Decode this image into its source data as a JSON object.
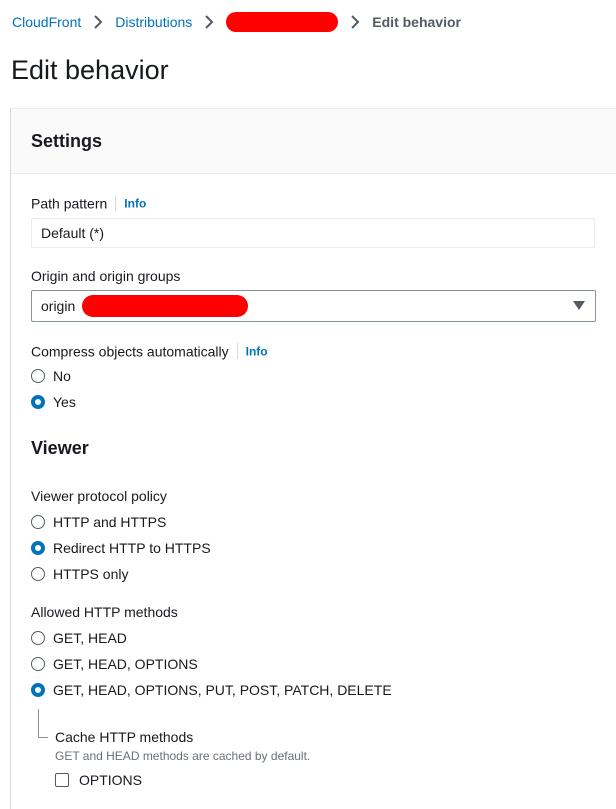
{
  "breadcrumb": {
    "items": [
      {
        "label": "CloudFront"
      },
      {
        "label": "Distributions"
      }
    ],
    "current": "Edit behavior"
  },
  "page_title": "Edit behavior",
  "settings": {
    "title": "Settings",
    "path_pattern": {
      "label": "Path pattern",
      "info": "Info",
      "value": "Default (*)"
    },
    "origin": {
      "label": "Origin and origin groups",
      "value_prefix": "origin"
    },
    "compress": {
      "label": "Compress objects automatically",
      "info": "Info",
      "options": [
        "No",
        "Yes"
      ],
      "selected": "Yes"
    }
  },
  "viewer": {
    "title": "Viewer",
    "protocol_policy": {
      "label": "Viewer protocol policy",
      "options": [
        "HTTP and HTTPS",
        "Redirect HTTP to HTTPS",
        "HTTPS only"
      ],
      "selected": "Redirect HTTP to HTTPS"
    },
    "allowed_methods": {
      "label": "Allowed HTTP methods",
      "options": [
        "GET, HEAD",
        "GET, HEAD, OPTIONS",
        "GET, HEAD, OPTIONS, PUT, POST, PATCH, DELETE"
      ],
      "selected": "GET, HEAD, OPTIONS, PUT, POST, PATCH, DELETE"
    },
    "cache_methods": {
      "label": "Cache HTTP methods",
      "description": "GET and HEAD methods are cached by default.",
      "options_label": "OPTIONS"
    }
  },
  "colors": {
    "link": "#0073bb",
    "redaction": "#ff0000",
    "text": "#16191f",
    "muted": "#545b64"
  },
  "icons": {
    "breadcrumb_separator": "chevron-right-icon",
    "select_caret": "caret-down-icon"
  }
}
